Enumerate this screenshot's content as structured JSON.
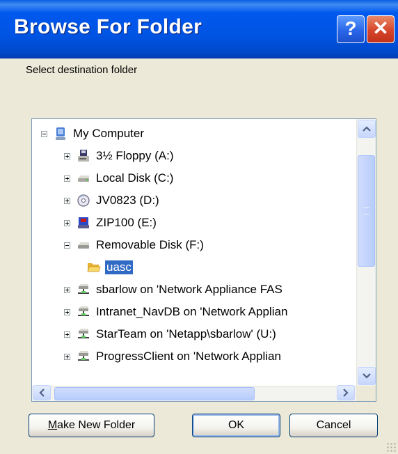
{
  "window": {
    "title": "Browse For Folder",
    "help_label": "?",
    "close_label": "✕",
    "prompt": "Select destination folder"
  },
  "tree": {
    "items": [
      {
        "label": "My Computer",
        "icon": "computer-icon",
        "expander": "minus",
        "selected": false
      },
      {
        "label": "3½ Floppy (A:)",
        "icon": "floppy-drive-icon",
        "expander": "plus",
        "selected": false
      },
      {
        "label": "Local Disk (C:)",
        "icon": "hard-disk-icon",
        "expander": "plus",
        "selected": false
      },
      {
        "label": "JV0823 (D:)",
        "icon": "cd-drive-icon",
        "expander": "plus",
        "selected": false
      },
      {
        "label": "ZIP100 (E:)",
        "icon": "zip-drive-icon",
        "expander": "plus",
        "selected": false
      },
      {
        "label": "Removable Disk (F:)",
        "icon": "removable-disk-icon",
        "expander": "minus",
        "selected": false
      },
      {
        "label": "uasc",
        "icon": "open-folder-icon",
        "expander": "none",
        "selected": true
      },
      {
        "label": "sbarlow on 'Network Appliance FAS",
        "icon": "network-drive-icon",
        "expander": "plus",
        "selected": false
      },
      {
        "label": "Intranet_NavDB on 'Network Applian",
        "icon": "network-drive-icon",
        "expander": "plus",
        "selected": false
      },
      {
        "label": "StarTeam on 'Netapp\\sbarlow' (U:)",
        "icon": "network-drive-icon",
        "expander": "plus",
        "selected": false
      },
      {
        "label": "ProgressClient on 'Network Applian",
        "icon": "network-drive-icon",
        "expander": "plus",
        "selected": false
      }
    ]
  },
  "buttons": {
    "make_new_folder": {
      "mnemonic": "M",
      "rest": "ake New Folder"
    },
    "ok": "OK",
    "cancel": "Cancel"
  },
  "colors": {
    "title_bar": "#0054e3",
    "selection": "#316ac5",
    "dialog_face": "#ece9d8",
    "close_button": "#d6452a"
  }
}
